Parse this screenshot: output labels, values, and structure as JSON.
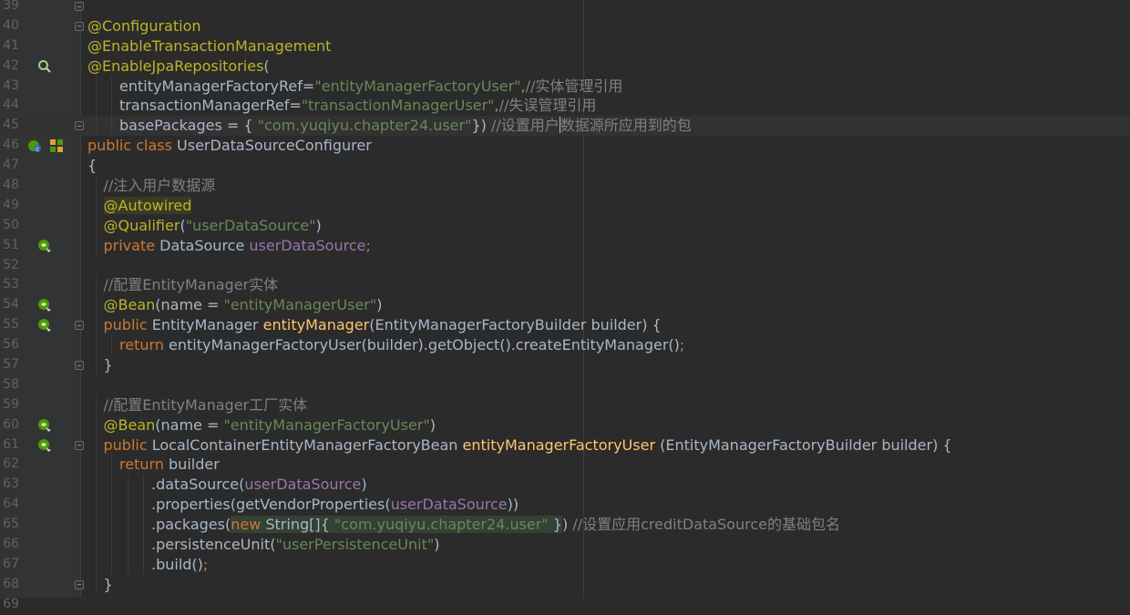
{
  "editor": {
    "lines": [
      {
        "n": "39",
        "indent": 0,
        "tokens": [],
        "fold": true
      },
      {
        "n": "40",
        "indent": 0,
        "tokens": [
          {
            "t": "@Configuration",
            "c": "ann"
          }
        ],
        "fold": true
      },
      {
        "n": "41",
        "indent": 0,
        "tokens": [
          {
            "t": "@EnableTransactionManagement",
            "c": "ann"
          }
        ]
      },
      {
        "n": "42",
        "indent": 0,
        "icon": "search-bean-icon",
        "tokens": [
          {
            "t": "@EnableJpaRepositories",
            "c": "ann"
          },
          {
            "t": "(",
            "c": "plain"
          }
        ]
      },
      {
        "n": "43",
        "indent": 2,
        "tokens": [
          {
            "t": "entityManagerFactoryRef",
            "c": "plain"
          },
          {
            "t": "=",
            "c": "plain"
          },
          {
            "t": "\"entityManagerFactoryUser\"",
            "c": "str"
          },
          {
            "t": ",",
            "c": "kw"
          },
          {
            "t": "//实体管理引用",
            "c": "cmt"
          }
        ]
      },
      {
        "n": "44",
        "indent": 2,
        "tokens": [
          {
            "t": "transactionManagerRef",
            "c": "plain"
          },
          {
            "t": "=",
            "c": "plain"
          },
          {
            "t": "\"transactionManagerUser\"",
            "c": "str"
          },
          {
            "t": ",",
            "c": "kw"
          },
          {
            "t": "//失误管理引用",
            "c": "cmt"
          }
        ]
      },
      {
        "n": "45",
        "indent": 2,
        "current": true,
        "fold": true,
        "tokens": [
          {
            "t": "basePackages",
            "c": "plain"
          },
          {
            "t": " = { ",
            "c": "plain"
          },
          {
            "t": "\"com.yuqiyu.chapter24.user\"",
            "c": "str"
          },
          {
            "t": "}) ",
            "c": "plain"
          },
          {
            "t": "//设置用户",
            "c": "cmt"
          },
          {
            "caret": true
          },
          {
            "t": "数据源所应用到的包",
            "c": "cmt"
          }
        ]
      },
      {
        "n": "46",
        "indent": 0,
        "icon": "spring-config-icon",
        "icon2": "diagram-icon",
        "tokens": [
          {
            "t": "public class ",
            "c": "kw"
          },
          {
            "t": "UserDataSourceConfigurer",
            "c": "plain"
          }
        ]
      },
      {
        "n": "47",
        "indent": 0,
        "tokens": [
          {
            "t": "{",
            "c": "plain"
          }
        ]
      },
      {
        "n": "48",
        "indent": 1,
        "tokens": [
          {
            "t": "//注入用户数据源",
            "c": "cmt"
          }
        ]
      },
      {
        "n": "49",
        "indent": 1,
        "tokens": [
          {
            "t": "@Autowired",
            "c": "ann",
            "hl": true
          }
        ]
      },
      {
        "n": "50",
        "indent": 1,
        "tokens": [
          {
            "t": "@Qualifier",
            "c": "ann"
          },
          {
            "t": "(",
            "c": "plain"
          },
          {
            "t": "\"userDataSource\"",
            "c": "str"
          },
          {
            "t": ")",
            "c": "plain"
          }
        ]
      },
      {
        "n": "51",
        "indent": 1,
        "icon": "bean-injection-icon",
        "tokens": [
          {
            "t": "private ",
            "c": "kw"
          },
          {
            "t": "DataSource ",
            "c": "plain"
          },
          {
            "t": "userDataSource",
            "c": "fld"
          },
          {
            "t": ";",
            "c": "kw"
          }
        ]
      },
      {
        "n": "52",
        "indent": 0,
        "tokens": []
      },
      {
        "n": "53",
        "indent": 1,
        "tokens": [
          {
            "t": "//配置EntityManager实体",
            "c": "cmt"
          }
        ]
      },
      {
        "n": "54",
        "indent": 1,
        "icon": "bean-icon",
        "tokens": [
          {
            "t": "@Bean",
            "c": "ann"
          },
          {
            "t": "(name = ",
            "c": "plain"
          },
          {
            "t": "\"entityManagerUser\"",
            "c": "str"
          },
          {
            "t": ")",
            "c": "plain"
          }
        ]
      },
      {
        "n": "55",
        "indent": 1,
        "icon": "bean-icon",
        "fold": true,
        "tokens": [
          {
            "t": "public ",
            "c": "kw"
          },
          {
            "t": "EntityManager ",
            "c": "plain"
          },
          {
            "t": "entityManager",
            "c": "fn"
          },
          {
            "t": "(EntityManagerFactoryBuilder builder) {",
            "c": "plain"
          }
        ]
      },
      {
        "n": "56",
        "indent": 2,
        "tokens": [
          {
            "t": "return ",
            "c": "kw"
          },
          {
            "t": "entityManagerFactoryUser(builder).getObject().createEntityManager()",
            "c": "plain"
          },
          {
            "t": ";",
            "c": "kw"
          }
        ]
      },
      {
        "n": "57",
        "indent": 1,
        "fold": true,
        "tokens": [
          {
            "t": "}",
            "c": "plain"
          }
        ]
      },
      {
        "n": "58",
        "indent": 0,
        "tokens": []
      },
      {
        "n": "59",
        "indent": 1,
        "tokens": [
          {
            "t": "//配置EntityManager工厂实体",
            "c": "cmt"
          }
        ]
      },
      {
        "n": "60",
        "indent": 1,
        "icon": "bean-icon",
        "tokens": [
          {
            "t": "@Bean",
            "c": "ann"
          },
          {
            "t": "(name = ",
            "c": "plain"
          },
          {
            "t": "\"entityManagerFactoryUser\"",
            "c": "str"
          },
          {
            "t": ")",
            "c": "plain"
          }
        ]
      },
      {
        "n": "61",
        "indent": 1,
        "icon": "bean-icon",
        "fold": true,
        "tokens": [
          {
            "t": "public ",
            "c": "kw"
          },
          {
            "t": "LocalContainerEntityManagerFactoryBean ",
            "c": "plain"
          },
          {
            "t": "entityManagerFactoryUser",
            "c": "fn"
          },
          {
            "t": " (EntityManagerFactoryBuilder builder) {",
            "c": "plain"
          }
        ]
      },
      {
        "n": "62",
        "indent": 2,
        "tokens": [
          {
            "t": "return ",
            "c": "kw"
          },
          {
            "t": "builder",
            "c": "plain"
          }
        ]
      },
      {
        "n": "63",
        "indent": 4,
        "tokens": [
          {
            "t": ".dataSource(",
            "c": "plain"
          },
          {
            "t": "userDataSource",
            "c": "fld"
          },
          {
            "t": ")",
            "c": "plain"
          }
        ]
      },
      {
        "n": "64",
        "indent": 4,
        "tokens": [
          {
            "t": ".properties(getVendorProperties(",
            "c": "plain"
          },
          {
            "t": "userDataSource",
            "c": "fld"
          },
          {
            "t": "))",
            "c": "plain"
          }
        ]
      },
      {
        "n": "65",
        "indent": 4,
        "tokens": [
          {
            "t": ".packages(",
            "c": "plain"
          },
          {
            "t": "new ",
            "c": "kw",
            "hl2": true
          },
          {
            "t": "String[]{ ",
            "c": "plain",
            "hl2": true
          },
          {
            "t": "\"com.yuqiyu.chapter24.user\"",
            "c": "str",
            "hl2": true
          },
          {
            "t": " }",
            "c": "plain",
            "hl2": true
          },
          {
            "t": ") ",
            "c": "plain"
          },
          {
            "t": "//设置应用creditDataSource的基础包名",
            "c": "cmt"
          }
        ]
      },
      {
        "n": "66",
        "indent": 4,
        "tokens": [
          {
            "t": ".persistenceUnit(",
            "c": "plain"
          },
          {
            "t": "\"userPersistenceUnit\"",
            "c": "str"
          },
          {
            "t": ")",
            "c": "plain"
          }
        ]
      },
      {
        "n": "67",
        "indent": 4,
        "tokens": [
          {
            "t": ".build()",
            "c": "plain"
          },
          {
            "t": ";",
            "c": "kw"
          }
        ]
      },
      {
        "n": "68",
        "indent": 1,
        "fold": true,
        "tokens": [
          {
            "t": "}",
            "c": "plain"
          }
        ]
      },
      {
        "n": "69",
        "indent": 0,
        "tokens": []
      }
    ]
  },
  "colors": {
    "background": "#2b2b2b",
    "gutter": "#313335",
    "annotation": "#bbb529",
    "keyword": "#cc7832",
    "string": "#6a8759",
    "comment": "#808080",
    "field": "#9876aa",
    "method": "#ffc66d",
    "text": "#a9b7c6"
  }
}
